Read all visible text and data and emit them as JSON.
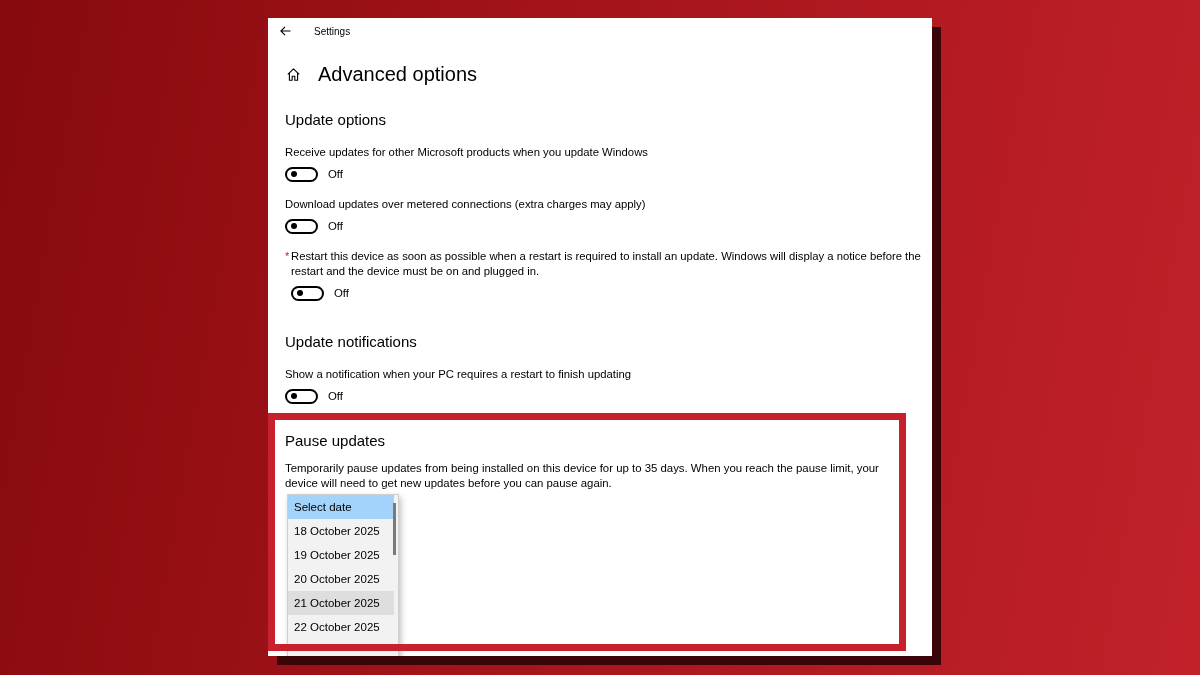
{
  "window": {
    "title": "Settings"
  },
  "page": {
    "title": "Advanced options"
  },
  "sections": [
    {
      "heading": "Update options",
      "settings": [
        {
          "label": "Receive updates for other Microsoft products when you update Windows",
          "on": false,
          "state_label": "Off"
        },
        {
          "label": "Download updates over metered connections (extra charges may apply)",
          "on": false,
          "state_label": "Off"
        },
        {
          "mark": "*",
          "label": "Restart this device as soon as possible when a restart is required to install an update. Windows will display a notice before the restart and the device must be on and plugged in.",
          "on": false,
          "state_label": "Off"
        }
      ]
    },
    {
      "heading": "Update notifications",
      "settings": [
        {
          "label": "Show a notification when your PC requires a restart to finish updating",
          "on": false,
          "state_label": "Off"
        }
      ]
    }
  ],
  "pause_updates": {
    "heading": "Pause updates",
    "highlighted": true,
    "description": "Temporarily pause updates from being installed on this device for up to 35 days. When you reach the pause limit, your device will need to get new updates before you can pause again.",
    "dropdown": {
      "items": [
        {
          "label": "Select date",
          "selected": true,
          "hovered": false
        },
        {
          "label": "18 October 2025",
          "selected": false,
          "hovered": false
        },
        {
          "label": "19 October 2025",
          "selected": false,
          "hovered": false
        },
        {
          "label": "20 October 2025",
          "selected": false,
          "hovered": false
        },
        {
          "label": "21 October 2025",
          "selected": false,
          "hovered": true
        },
        {
          "label": "22 October 2025",
          "selected": false,
          "hovered": false
        }
      ]
    }
  }
}
